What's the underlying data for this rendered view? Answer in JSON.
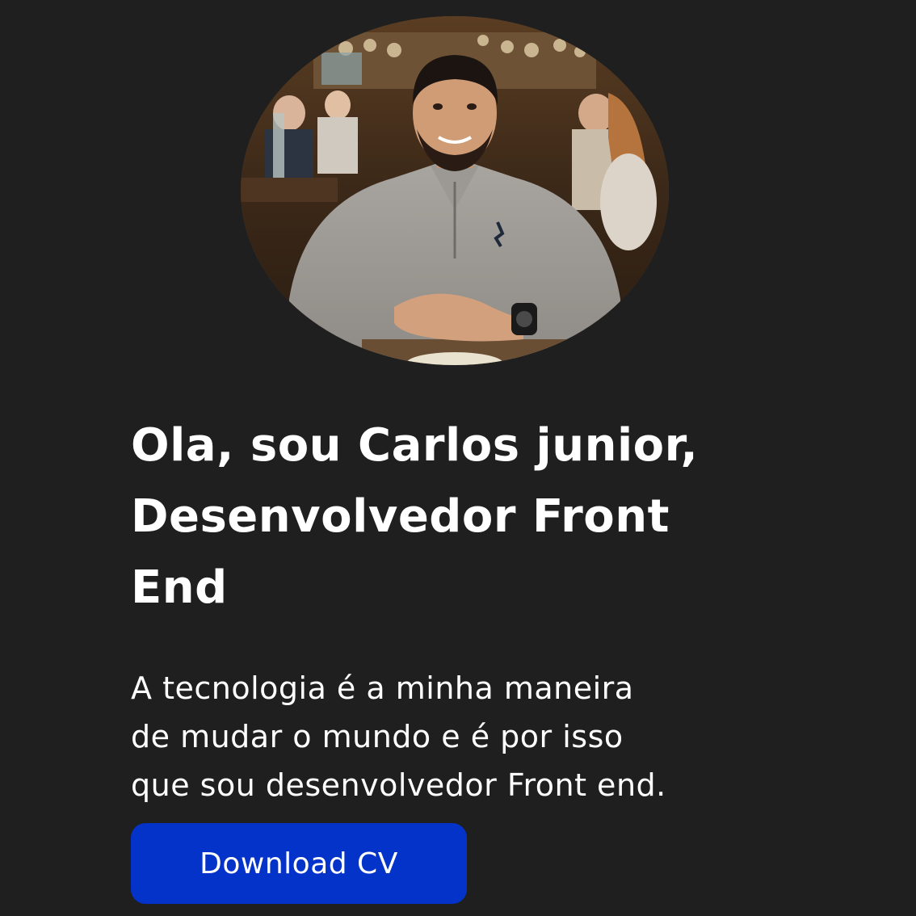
{
  "profile": {
    "photo_alt": "Carlos junior",
    "headline_lines": [
      "Ola, sou Carlos junior,",
      "Desenvolvedor Front",
      "End"
    ],
    "description_lines": [
      "A tecnologia é a minha maneira",
      "de mudar o mundo e é por isso",
      "que sou desenvolvedor Front end."
    ],
    "download_button_label": "Download CV"
  },
  "colors": {
    "background": "#1f1f1f",
    "text": "#ffffff",
    "button": "#0433c9"
  }
}
